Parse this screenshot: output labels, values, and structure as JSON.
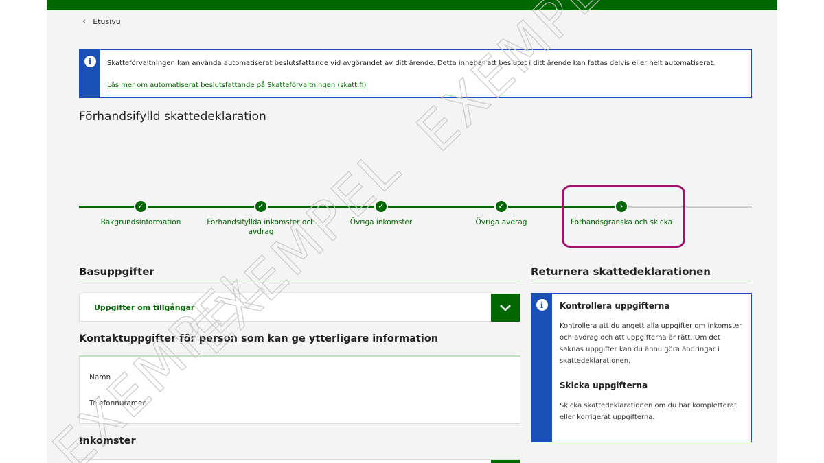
{
  "nav": {
    "back_label": "Etusivu"
  },
  "banner": {
    "text": "Skatteförvaltningen kan använda automatiserat beslutsfattande vid avgörandet av ditt ärende. Detta innebär att beslutet i ditt ärende kan fattas delvis eller helt automatiserat.",
    "link": "Läs mer om automatiserat beslutsfattande på Skatteförvaltningen (skatt.fi)"
  },
  "page_title": "Förhandsifylld skattedeklaration",
  "steps": [
    {
      "label": "Bakgrundsinformation",
      "status": "done"
    },
    {
      "label": "Förhandsifyllda inkomster och avdrag",
      "status": "done"
    },
    {
      "label": "Övriga inkomster",
      "status": "done"
    },
    {
      "label": "Övriga avdrag",
      "status": "done"
    },
    {
      "label": "Förhandsgranska och skicka",
      "status": "current"
    }
  ],
  "basic": {
    "title": "Basuppgifter",
    "accordion_label": "Uppgifter om tillgångar"
  },
  "contact": {
    "title": "Kontaktuppgifter för person som kan ge ytterligare information",
    "name_label": "Namn",
    "phone_label": "Telefonnummer"
  },
  "income": {
    "title": "Inkomster"
  },
  "return_section": {
    "title": "Returnera skattedeklarationen",
    "check_title": "Kontrollera uppgifterna",
    "check_text": "Kontrollera att du angett alla uppgifter om inkomster och avdrag och att uppgifterna är rätt. Om det saknas uppgifter kan du ännu göra ändringar i skattedeklarationen.",
    "send_title": "Skicka uppgifterna",
    "send_text": "Skicka skattedeklarationen om du har kompletterat eller korrigerat uppgifterna."
  },
  "watermark": "EXEMPEL",
  "colors": {
    "brand_green": "#006600",
    "info_blue": "#1a4fb5",
    "highlight": "#a1126b",
    "todo_gray": "#cccccc"
  },
  "icons": {
    "back": "chevron-left-icon",
    "info": "info-icon",
    "done": "check-icon",
    "current": "chevron-right-icon",
    "accordion": "chevron-down-icon"
  }
}
